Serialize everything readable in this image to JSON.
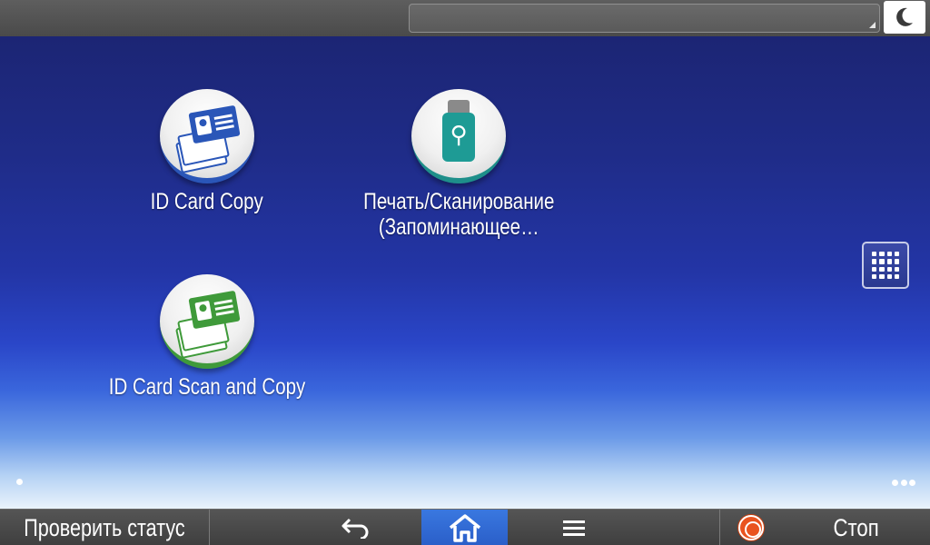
{
  "topbar": {
    "status_text": ""
  },
  "icons": {
    "sleep": "moon-icon",
    "app_list": "grid-icon",
    "back": "back-arrow-icon",
    "home": "home-icon",
    "menu": "menu-icon",
    "stop": "stop-icon",
    "more": "more-dots-icon"
  },
  "apps": [
    {
      "label_lines": [
        "ID Card Copy"
      ],
      "color": "#2a56b8"
    },
    {
      "label_lines": [
        "Печать/Сканирование",
        "(Запоминающее…"
      ],
      "color": "#1e9b95"
    },
    {
      "label_lines": [
        "ID Card Scan and Copy"
      ],
      "color": "#3f9a3a"
    }
  ],
  "bottombar": {
    "check_status_label": "Проверить статус",
    "stop_label": "Стоп"
  },
  "colors": {
    "home_active": "#2a5ec8",
    "stop": "#e9531f"
  }
}
